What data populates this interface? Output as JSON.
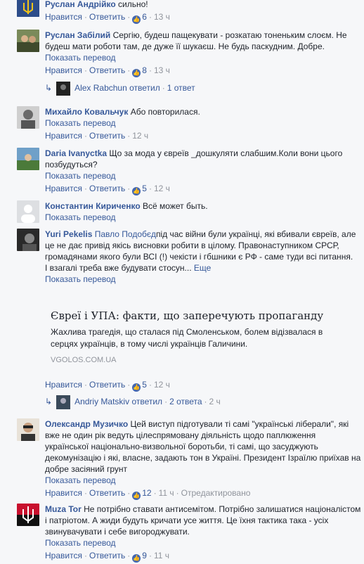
{
  "ui": {
    "like": "Нравится",
    "reply": "Ответить",
    "show_translation": "Показать перевод",
    "dot": "·"
  },
  "comments": [
    {
      "author": "Руслан Андрійко",
      "text": "сильно!",
      "likes": "6",
      "time": "13 ч"
    },
    {
      "author": "Руслан Забілий",
      "text": "Сергію, будеш пащекувати - розкатаю тоненьким слоєм. Не будеш мати роботи там, де дуже її шукаєш. Не будь паскудним. Добре.",
      "likes": "8",
      "time": "13 ч"
    },
    {
      "author": "Михайло Ковальчук",
      "text": "Або повторилася.",
      "time": "12 ч"
    },
    {
      "author": "Daria Ivanyctka",
      "text": "Що за мода у євреїв _дошкуляти слабшим.Коли вони цього позбудуться?",
      "likes": "5",
      "time": "12 ч"
    },
    {
      "author": "Константин Кириченко",
      "text": "Всё может быть.",
      "time": "12 ч"
    },
    {
      "author": "Yuri Pekelis",
      "mention": "Павло Подобєд",
      "text": "під час війни були українці, які вбивали євреїв, але це не дає привід якісь висновки робити в цілому. Правонаступником СРСР, громадянами якого були ВСІ (!) чекісти і гбшники є РФ - саме туди всі питання.",
      "text2": "І взагалі треба вже будувати стосун...",
      "more": "Еще",
      "likes": "5",
      "time": "12 ч"
    },
    {
      "author": "Олександр Музичко",
      "text": "Цей виступ підготували ті самі \"українські ліберали\", які вже не один рік ведуть цілеспрямовану діяльність щодо паплюження української національно-визвольної боротьби, ті самі, що засуджують декомунізацію і які, власне, задають тон в Україні. Президент Ізраїлю приїхав на добре засіяний грунт",
      "likes": "12",
      "time": "11 ч",
      "edited": "Отредактировано"
    },
    {
      "author": "Muza Tor",
      "text": "Не потрібно ставати антисемітом. Потрібно залишатися націоналістом і патріотом. А жиди будуть кричати усе життя. Це їхня тактика така - усіх звинувачувати і себе вигороджувати.",
      "likes": "9",
      "time": "11 ч"
    }
  ],
  "reply_threads": [
    {
      "author": "Alex Rabchun",
      "action": "ответил",
      "count": "1 ответ"
    },
    {
      "author": "Andriy Matskiv",
      "action": "ответил",
      "count": "2 ответа",
      "time": "2 ч"
    }
  ],
  "link_preview": {
    "title": "Євреї і УПА: факти, що заперечують пропаганду",
    "description": "Жахлива трагедія, що сталася під Смоленськом, болем відізвалася в серцях українців, в тому числі українців Галичини.",
    "source": "VGOLOS.COM.UA"
  },
  "colors": {
    "link": "#365899",
    "meta": "#90949c",
    "like_badge": "#4267b2",
    "bg": "#f6f7f9"
  }
}
